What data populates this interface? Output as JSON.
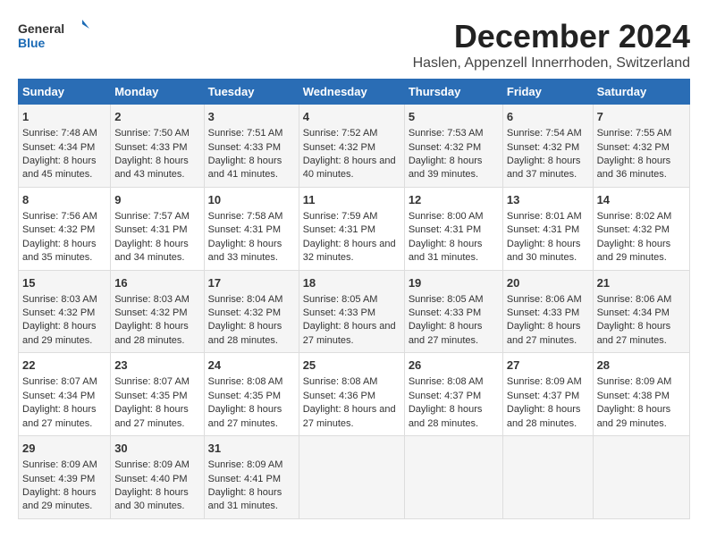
{
  "logo": {
    "general": "General",
    "blue": "Blue"
  },
  "title": "December 2024",
  "subtitle": "Haslen, Appenzell Innerrhoden, Switzerland",
  "days_header": [
    "Sunday",
    "Monday",
    "Tuesday",
    "Wednesday",
    "Thursday",
    "Friday",
    "Saturday"
  ],
  "weeks": [
    [
      {
        "day": "1",
        "sunrise": "Sunrise: 7:48 AM",
        "sunset": "Sunset: 4:34 PM",
        "daylight": "Daylight: 8 hours and 45 minutes."
      },
      {
        "day": "2",
        "sunrise": "Sunrise: 7:50 AM",
        "sunset": "Sunset: 4:33 PM",
        "daylight": "Daylight: 8 hours and 43 minutes."
      },
      {
        "day": "3",
        "sunrise": "Sunrise: 7:51 AM",
        "sunset": "Sunset: 4:33 PM",
        "daylight": "Daylight: 8 hours and 41 minutes."
      },
      {
        "day": "4",
        "sunrise": "Sunrise: 7:52 AM",
        "sunset": "Sunset: 4:32 PM",
        "daylight": "Daylight: 8 hours and 40 minutes."
      },
      {
        "day": "5",
        "sunrise": "Sunrise: 7:53 AM",
        "sunset": "Sunset: 4:32 PM",
        "daylight": "Daylight: 8 hours and 39 minutes."
      },
      {
        "day": "6",
        "sunrise": "Sunrise: 7:54 AM",
        "sunset": "Sunset: 4:32 PM",
        "daylight": "Daylight: 8 hours and 37 minutes."
      },
      {
        "day": "7",
        "sunrise": "Sunrise: 7:55 AM",
        "sunset": "Sunset: 4:32 PM",
        "daylight": "Daylight: 8 hours and 36 minutes."
      }
    ],
    [
      {
        "day": "8",
        "sunrise": "Sunrise: 7:56 AM",
        "sunset": "Sunset: 4:32 PM",
        "daylight": "Daylight: 8 hours and 35 minutes."
      },
      {
        "day": "9",
        "sunrise": "Sunrise: 7:57 AM",
        "sunset": "Sunset: 4:31 PM",
        "daylight": "Daylight: 8 hours and 34 minutes."
      },
      {
        "day": "10",
        "sunrise": "Sunrise: 7:58 AM",
        "sunset": "Sunset: 4:31 PM",
        "daylight": "Daylight: 8 hours and 33 minutes."
      },
      {
        "day": "11",
        "sunrise": "Sunrise: 7:59 AM",
        "sunset": "Sunset: 4:31 PM",
        "daylight": "Daylight: 8 hours and 32 minutes."
      },
      {
        "day": "12",
        "sunrise": "Sunrise: 8:00 AM",
        "sunset": "Sunset: 4:31 PM",
        "daylight": "Daylight: 8 hours and 31 minutes."
      },
      {
        "day": "13",
        "sunrise": "Sunrise: 8:01 AM",
        "sunset": "Sunset: 4:31 PM",
        "daylight": "Daylight: 8 hours and 30 minutes."
      },
      {
        "day": "14",
        "sunrise": "Sunrise: 8:02 AM",
        "sunset": "Sunset: 4:32 PM",
        "daylight": "Daylight: 8 hours and 29 minutes."
      }
    ],
    [
      {
        "day": "15",
        "sunrise": "Sunrise: 8:03 AM",
        "sunset": "Sunset: 4:32 PM",
        "daylight": "Daylight: 8 hours and 29 minutes."
      },
      {
        "day": "16",
        "sunrise": "Sunrise: 8:03 AM",
        "sunset": "Sunset: 4:32 PM",
        "daylight": "Daylight: 8 hours and 28 minutes."
      },
      {
        "day": "17",
        "sunrise": "Sunrise: 8:04 AM",
        "sunset": "Sunset: 4:32 PM",
        "daylight": "Daylight: 8 hours and 28 minutes."
      },
      {
        "day": "18",
        "sunrise": "Sunrise: 8:05 AM",
        "sunset": "Sunset: 4:33 PM",
        "daylight": "Daylight: 8 hours and 27 minutes."
      },
      {
        "day": "19",
        "sunrise": "Sunrise: 8:05 AM",
        "sunset": "Sunset: 4:33 PM",
        "daylight": "Daylight: 8 hours and 27 minutes."
      },
      {
        "day": "20",
        "sunrise": "Sunrise: 8:06 AM",
        "sunset": "Sunset: 4:33 PM",
        "daylight": "Daylight: 8 hours and 27 minutes."
      },
      {
        "day": "21",
        "sunrise": "Sunrise: 8:06 AM",
        "sunset": "Sunset: 4:34 PM",
        "daylight": "Daylight: 8 hours and 27 minutes."
      }
    ],
    [
      {
        "day": "22",
        "sunrise": "Sunrise: 8:07 AM",
        "sunset": "Sunset: 4:34 PM",
        "daylight": "Daylight: 8 hours and 27 minutes."
      },
      {
        "day": "23",
        "sunrise": "Sunrise: 8:07 AM",
        "sunset": "Sunset: 4:35 PM",
        "daylight": "Daylight: 8 hours and 27 minutes."
      },
      {
        "day": "24",
        "sunrise": "Sunrise: 8:08 AM",
        "sunset": "Sunset: 4:35 PM",
        "daylight": "Daylight: 8 hours and 27 minutes."
      },
      {
        "day": "25",
        "sunrise": "Sunrise: 8:08 AM",
        "sunset": "Sunset: 4:36 PM",
        "daylight": "Daylight: 8 hours and 27 minutes."
      },
      {
        "day": "26",
        "sunrise": "Sunrise: 8:08 AM",
        "sunset": "Sunset: 4:37 PM",
        "daylight": "Daylight: 8 hours and 28 minutes."
      },
      {
        "day": "27",
        "sunrise": "Sunrise: 8:09 AM",
        "sunset": "Sunset: 4:37 PM",
        "daylight": "Daylight: 8 hours and 28 minutes."
      },
      {
        "day": "28",
        "sunrise": "Sunrise: 8:09 AM",
        "sunset": "Sunset: 4:38 PM",
        "daylight": "Daylight: 8 hours and 29 minutes."
      }
    ],
    [
      {
        "day": "29",
        "sunrise": "Sunrise: 8:09 AM",
        "sunset": "Sunset: 4:39 PM",
        "daylight": "Daylight: 8 hours and 29 minutes."
      },
      {
        "day": "30",
        "sunrise": "Sunrise: 8:09 AM",
        "sunset": "Sunset: 4:40 PM",
        "daylight": "Daylight: 8 hours and 30 minutes."
      },
      {
        "day": "31",
        "sunrise": "Sunrise: 8:09 AM",
        "sunset": "Sunset: 4:41 PM",
        "daylight": "Daylight: 8 hours and 31 minutes."
      },
      null,
      null,
      null,
      null
    ]
  ]
}
